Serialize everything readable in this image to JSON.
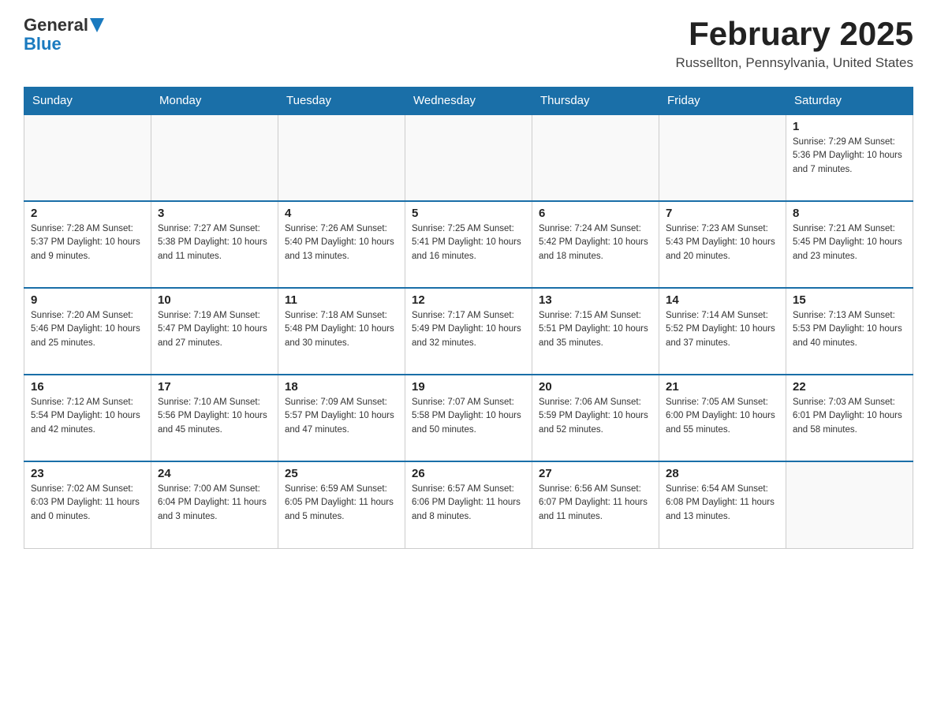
{
  "logo": {
    "text_general": "General",
    "text_blue": "Blue"
  },
  "title": "February 2025",
  "location": "Russellton, Pennsylvania, United States",
  "days_of_week": [
    "Sunday",
    "Monday",
    "Tuesday",
    "Wednesday",
    "Thursday",
    "Friday",
    "Saturday"
  ],
  "weeks": [
    [
      {
        "day": "",
        "info": ""
      },
      {
        "day": "",
        "info": ""
      },
      {
        "day": "",
        "info": ""
      },
      {
        "day": "",
        "info": ""
      },
      {
        "day": "",
        "info": ""
      },
      {
        "day": "",
        "info": ""
      },
      {
        "day": "1",
        "info": "Sunrise: 7:29 AM\nSunset: 5:36 PM\nDaylight: 10 hours and 7 minutes."
      }
    ],
    [
      {
        "day": "2",
        "info": "Sunrise: 7:28 AM\nSunset: 5:37 PM\nDaylight: 10 hours and 9 minutes."
      },
      {
        "day": "3",
        "info": "Sunrise: 7:27 AM\nSunset: 5:38 PM\nDaylight: 10 hours and 11 minutes."
      },
      {
        "day": "4",
        "info": "Sunrise: 7:26 AM\nSunset: 5:40 PM\nDaylight: 10 hours and 13 minutes."
      },
      {
        "day": "5",
        "info": "Sunrise: 7:25 AM\nSunset: 5:41 PM\nDaylight: 10 hours and 16 minutes."
      },
      {
        "day": "6",
        "info": "Sunrise: 7:24 AM\nSunset: 5:42 PM\nDaylight: 10 hours and 18 minutes."
      },
      {
        "day": "7",
        "info": "Sunrise: 7:23 AM\nSunset: 5:43 PM\nDaylight: 10 hours and 20 minutes."
      },
      {
        "day": "8",
        "info": "Sunrise: 7:21 AM\nSunset: 5:45 PM\nDaylight: 10 hours and 23 minutes."
      }
    ],
    [
      {
        "day": "9",
        "info": "Sunrise: 7:20 AM\nSunset: 5:46 PM\nDaylight: 10 hours and 25 minutes."
      },
      {
        "day": "10",
        "info": "Sunrise: 7:19 AM\nSunset: 5:47 PM\nDaylight: 10 hours and 27 minutes."
      },
      {
        "day": "11",
        "info": "Sunrise: 7:18 AM\nSunset: 5:48 PM\nDaylight: 10 hours and 30 minutes."
      },
      {
        "day": "12",
        "info": "Sunrise: 7:17 AM\nSunset: 5:49 PM\nDaylight: 10 hours and 32 minutes."
      },
      {
        "day": "13",
        "info": "Sunrise: 7:15 AM\nSunset: 5:51 PM\nDaylight: 10 hours and 35 minutes."
      },
      {
        "day": "14",
        "info": "Sunrise: 7:14 AM\nSunset: 5:52 PM\nDaylight: 10 hours and 37 minutes."
      },
      {
        "day": "15",
        "info": "Sunrise: 7:13 AM\nSunset: 5:53 PM\nDaylight: 10 hours and 40 minutes."
      }
    ],
    [
      {
        "day": "16",
        "info": "Sunrise: 7:12 AM\nSunset: 5:54 PM\nDaylight: 10 hours and 42 minutes."
      },
      {
        "day": "17",
        "info": "Sunrise: 7:10 AM\nSunset: 5:56 PM\nDaylight: 10 hours and 45 minutes."
      },
      {
        "day": "18",
        "info": "Sunrise: 7:09 AM\nSunset: 5:57 PM\nDaylight: 10 hours and 47 minutes."
      },
      {
        "day": "19",
        "info": "Sunrise: 7:07 AM\nSunset: 5:58 PM\nDaylight: 10 hours and 50 minutes."
      },
      {
        "day": "20",
        "info": "Sunrise: 7:06 AM\nSunset: 5:59 PM\nDaylight: 10 hours and 52 minutes."
      },
      {
        "day": "21",
        "info": "Sunrise: 7:05 AM\nSunset: 6:00 PM\nDaylight: 10 hours and 55 minutes."
      },
      {
        "day": "22",
        "info": "Sunrise: 7:03 AM\nSunset: 6:01 PM\nDaylight: 10 hours and 58 minutes."
      }
    ],
    [
      {
        "day": "23",
        "info": "Sunrise: 7:02 AM\nSunset: 6:03 PM\nDaylight: 11 hours and 0 minutes."
      },
      {
        "day": "24",
        "info": "Sunrise: 7:00 AM\nSunset: 6:04 PM\nDaylight: 11 hours and 3 minutes."
      },
      {
        "day": "25",
        "info": "Sunrise: 6:59 AM\nSunset: 6:05 PM\nDaylight: 11 hours and 5 minutes."
      },
      {
        "day": "26",
        "info": "Sunrise: 6:57 AM\nSunset: 6:06 PM\nDaylight: 11 hours and 8 minutes."
      },
      {
        "day": "27",
        "info": "Sunrise: 6:56 AM\nSunset: 6:07 PM\nDaylight: 11 hours and 11 minutes."
      },
      {
        "day": "28",
        "info": "Sunrise: 6:54 AM\nSunset: 6:08 PM\nDaylight: 11 hours and 13 minutes."
      },
      {
        "day": "",
        "info": ""
      }
    ]
  ]
}
